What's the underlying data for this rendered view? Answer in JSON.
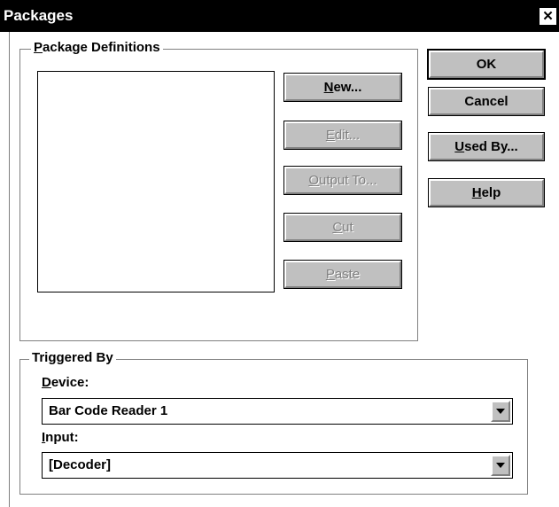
{
  "window": {
    "title": "Packages",
    "close_glyph": "✕"
  },
  "package_definitions": {
    "legend": "Package Definitions",
    "legend_mnemonic": "P",
    "legend_rest": "ackage Definitions",
    "items": []
  },
  "buttons": {
    "new": {
      "label": "New...",
      "mn": "N",
      "rest": "ew..."
    },
    "edit": {
      "label": "Edit...",
      "mn": "E",
      "rest": "dit..."
    },
    "output_to": {
      "label": "Output To...",
      "mn": "O",
      "rest": "utput To..."
    },
    "cut": {
      "label": "Cut",
      "mn": "C",
      "rest": "ut"
    },
    "paste": {
      "label": "Paste",
      "mn": "P",
      "rest": "aste"
    },
    "ok": {
      "label": "OK"
    },
    "cancel": {
      "label": "Cancel"
    },
    "used_by": {
      "label": "Used By...",
      "mn": "U",
      "rest": "sed By..."
    },
    "help": {
      "label": "Help",
      "mn": "H",
      "rest": "elp"
    }
  },
  "triggered_by": {
    "legend": "Triggered By",
    "device_label_mn": "D",
    "device_label_rest": "evice:",
    "device_value": "Bar Code Reader 1",
    "input_label_mn": "I",
    "input_label_rest": "nput:",
    "input_value": "[Decoder]"
  }
}
